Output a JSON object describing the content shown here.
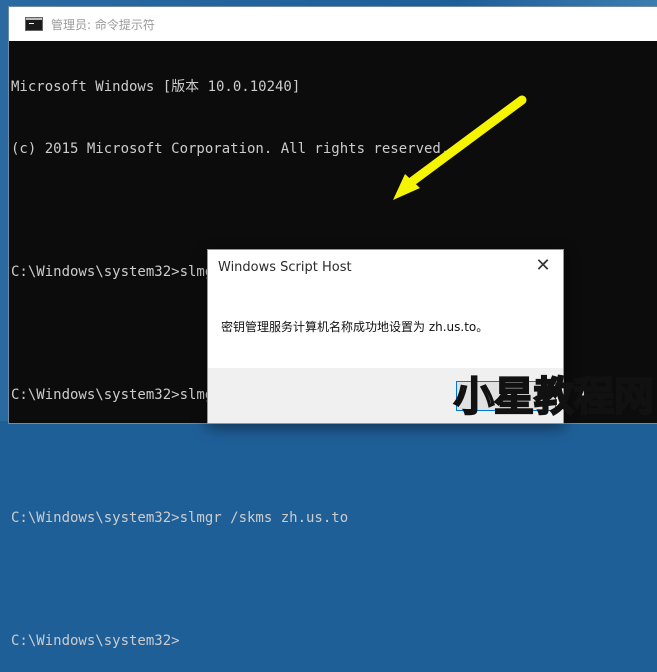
{
  "window": {
    "title": "管理员: 命令提示符",
    "icon": "cmd-icon"
  },
  "console": {
    "lines": [
      "Microsoft Windows [版本 10.0.10240]",
      "(c) 2015 Microsoft Corporation. All rights reserved.",
      "",
      "C:\\Windows\\system32>slmgr.vbs /upk",
      "",
      "C:\\Windows\\system32>slmgr /ipk W269N-WFGWX-YVC9B-4J6C9-T83GX",
      "",
      "C:\\Windows\\system32>slmgr /skms zh.us.to",
      "",
      "C:\\Windows\\system32>"
    ]
  },
  "annotation": {
    "arrow_color": "#f5f500"
  },
  "dialog": {
    "title": "Windows Script Host",
    "close_icon": "close-icon",
    "message": "密钥管理服务计算机名称成功地设置为 zh.us.to。",
    "ok_label": ""
  },
  "watermark": {
    "text": "小星教程网"
  },
  "colors": {
    "console_bg": "#0c0c0c",
    "console_text": "#cccccc",
    "focus_border": "#0078d7"
  }
}
